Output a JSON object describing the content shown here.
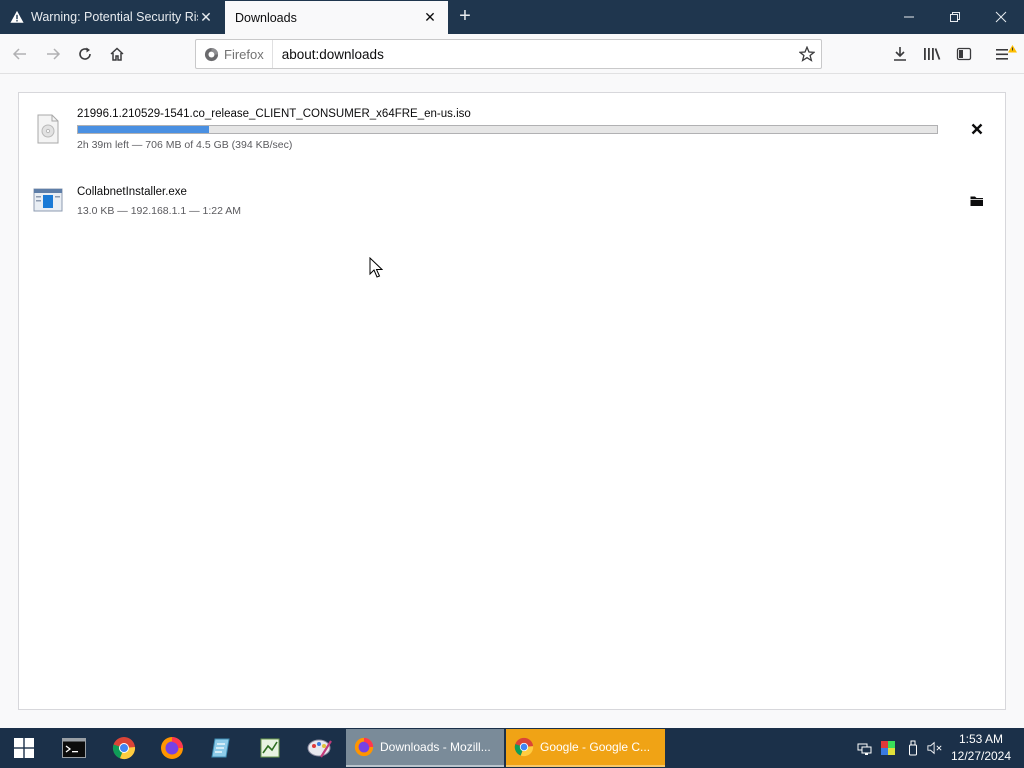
{
  "tabs": [
    {
      "title": "Warning: Potential Security Risk Ahead",
      "active": false
    },
    {
      "title": "Downloads",
      "active": true
    }
  ],
  "navbar": {
    "identity_label": "Firefox",
    "url": "about:downloads"
  },
  "downloads": [
    {
      "name": "21996.1.210529-1541.co_release_CLIENT_CONSUMER_x64FRE_en-us.iso",
      "status": "2h 39m left — 706 MB of 4.5 GB (394 KB/sec)",
      "progress_fraction": 0.152,
      "action_icon": "cancel-icon"
    },
    {
      "name": "CollabnetInstaller.exe",
      "status": "13.0 KB — 192.168.1.1 — 1:22 AM",
      "action_icon": "folder-icon"
    }
  ],
  "taskbar": {
    "tasks": [
      {
        "label": "Downloads - Mozill...",
        "app": "firefox"
      },
      {
        "label": "Google - Google C...",
        "app": "chrome"
      }
    ],
    "clock": {
      "time": "1:53 AM",
      "date": "12/27/2024"
    }
  },
  "colors": {
    "tabbar": "#1f364e",
    "progress": "#4a90e2",
    "taskbar": "#1b3049",
    "task_active_firefox": "#7a8b99",
    "task_chrome": "#f0a315"
  }
}
